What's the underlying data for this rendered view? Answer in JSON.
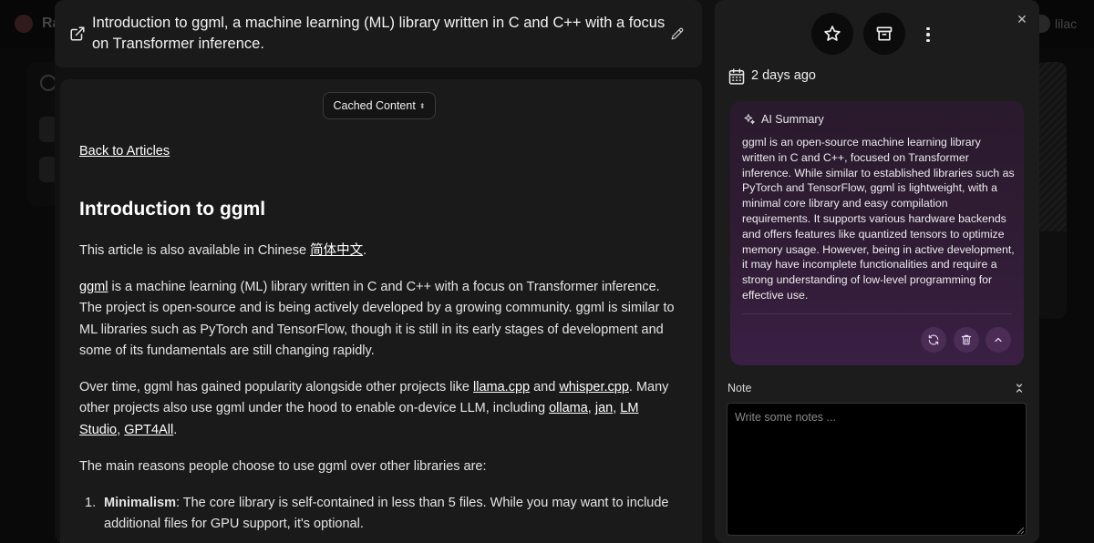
{
  "background": {
    "brand": "Ra",
    "user": "lilac"
  },
  "modal": {
    "title": "Introduction to ggml, a machine learning (ML) library written in C and C++ with a focus on Transformer inference.",
    "content_mode": "Cached Content",
    "back_link": "Back to Articles",
    "heading": "Introduction to ggml",
    "p1": {
      "text_before": "This article is also available in Chinese ",
      "link": "简体中文",
      "text_after": "."
    },
    "p2": {
      "link": "ggml",
      "text": " is a machine learning (ML) library written in C and C++ with a focus on Transformer inference. The project is open-source and is being actively developed by a growing community. ggml is similar to ML libraries such as PyTorch and TensorFlow, though it is still in its early stages of development and some of its fundamentals are still changing rapidly."
    },
    "p3": {
      "t1": "Over time, ggml has gained popularity alongside other projects like ",
      "link1": "llama.cpp",
      "t2": " and ",
      "link2": "whisper.cpp",
      "t3": ". Many other projects also use ggml under the hood to enable on-device LLM, including ",
      "link3": "ollama",
      "t4": ", ",
      "link4": "jan",
      "t5": ", ",
      "link5": "LM Studio",
      "t6": ", ",
      "link6": "GPT4All",
      "t7": "."
    },
    "p4": "The main reasons people choose to use ggml over other libraries are:",
    "list_item_1": {
      "num": "1.",
      "bold": "Minimalism",
      "text": ": The core library is self-contained in less than 5 files. While you may want to include additional files for GPU support, it's optional."
    }
  },
  "panel": {
    "date": "2 days ago",
    "summary_title": "AI Summary",
    "summary_body": "ggml is an open-source machine learning library written in C and C++, focused on Transformer inference. While similar to established libraries such as PyTorch and TensorFlow, ggml is lightweight, with a minimal core library and easy compilation requirements. It supports various hardware backends and offers features like quantized tensors to optimize memory usage. However, being in active development, it may have incomplete functionalities and require a strong understanding of low-level programming for effective use.",
    "note_label": "Note",
    "note_placeholder": "Write some notes ..."
  }
}
